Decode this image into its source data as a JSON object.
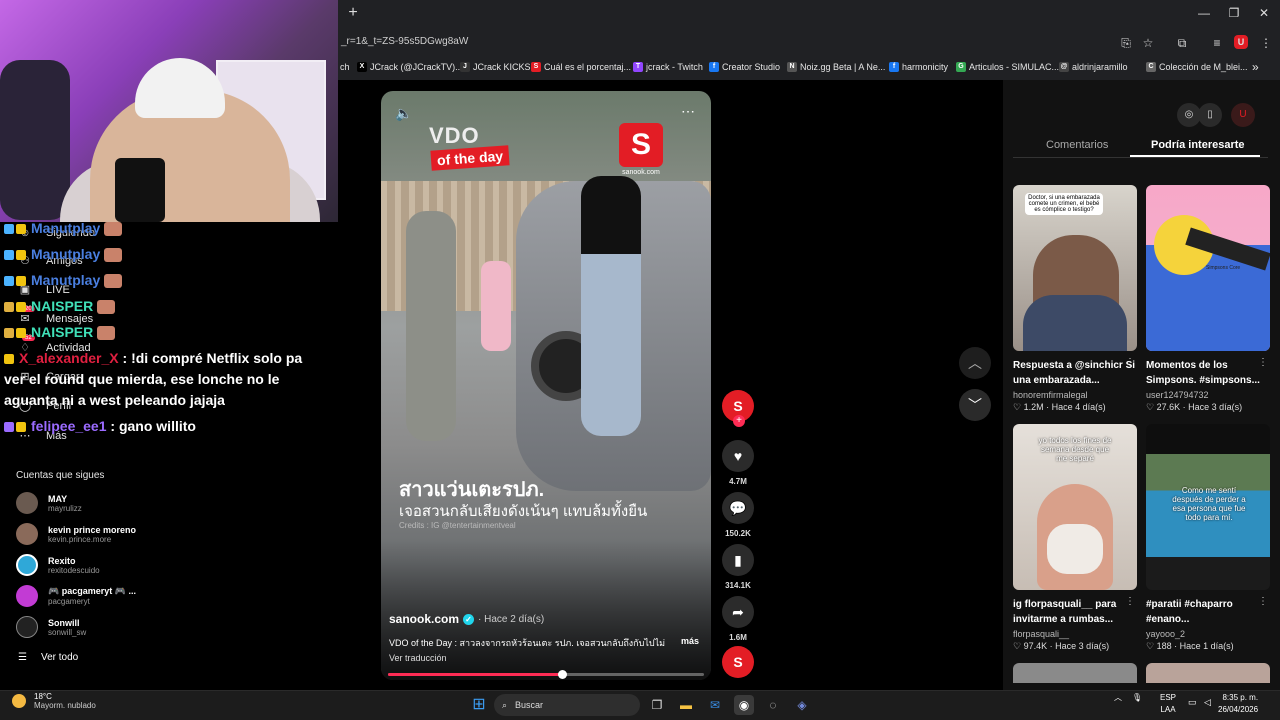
{
  "browser": {
    "url": "_r=1&_t=ZS-95s5DGwg8aW",
    "new_tab": "+",
    "bookmarks": [
      {
        "label": "ch",
        "icon": ""
      },
      {
        "label": "JCrack (@JCrackTV)...",
        "icon": "X"
      },
      {
        "label": "JCrack KICKS",
        "icon": "J"
      },
      {
        "label": "Cuál es el porcentaj...",
        "icon": "S"
      },
      {
        "label": "jcrack - Twitch",
        "icon": "T"
      },
      {
        "label": "Creator Studio",
        "icon": "f"
      },
      {
        "label": "Noiz.gg Beta | A Ne...",
        "icon": "N"
      },
      {
        "label": "harmonicity",
        "icon": "f"
      },
      {
        "label": "Articulos - SIMULAC...",
        "icon": "G"
      },
      {
        "label": "aldrinjaramillo",
        "icon": "@"
      },
      {
        "label": "Colección de M_blei...",
        "icon": "C"
      }
    ],
    "bookmarks_more": "»"
  },
  "sidebar": {
    "nav": [
      {
        "label": "Siguiendo",
        "icon": "following-icon"
      },
      {
        "label": "Amigos",
        "icon": "friends-icon"
      },
      {
        "label": "LIVE",
        "icon": "live-icon"
      },
      {
        "label": "Mensajes",
        "icon": "messages-icon",
        "badge": "20"
      },
      {
        "label": "Actividad",
        "icon": "activity-icon",
        "badge": "52"
      },
      {
        "label": "Cargar",
        "icon": "upload-icon"
      },
      {
        "label": "Perfil",
        "icon": "profile-icon"
      },
      {
        "label": "Más",
        "icon": "more-icon"
      }
    ],
    "following_title": "Cuentas que sigues",
    "following": [
      {
        "name": "MAY",
        "user": "mayrulizz"
      },
      {
        "name": "kevin prince moreno",
        "user": "kevin.prince.more"
      },
      {
        "name": "Rexito",
        "user": "rexitodescuido"
      },
      {
        "name": "🎮 pacgameryt 🎮 ...",
        "user": "pacgameryt"
      },
      {
        "name": "Sonwill",
        "user": "sonwill_sw"
      }
    ],
    "see_all": "Ver todo"
  },
  "chat": [
    {
      "user": "Manutplay",
      "color": "#4a7fe0",
      "text": ""
    },
    {
      "user": "Manutplay",
      "color": "#4a7fe0",
      "text": ""
    },
    {
      "user": "Manutplay",
      "color": "#4a7fe0",
      "text": ""
    },
    {
      "user": "NAISPER",
      "color": "#40e0b8",
      "text": ""
    },
    {
      "user": "NAISPER",
      "color": "#40e0b8",
      "text": ""
    },
    {
      "user": "X_alexander_X",
      "color": "#e02040",
      "text": "!di compré Netflix solo pa"
    },
    {
      "user": "",
      "color": "#ffffff",
      "text": "ver el round que mierda, ese lonche no le"
    },
    {
      "user": "",
      "color": "#ffffff",
      "text": "aguanta ni a west peleando jajaja"
    },
    {
      "user": "felipee_ee1",
      "color": "#9b6bff",
      "text": "gano willito"
    }
  ],
  "video": {
    "logo_line1": "VDO",
    "logo_line2": "of the day",
    "brand_letter": "S",
    "brand_sub": "sanook.com",
    "headline": "สาวแว่นเตะรปภ.",
    "subhead": "เจอสวนกลับเสียงดังเน้นๆ แทบล้มทั้งยืน",
    "credits": "Credits : IG @tentertainmentveal",
    "author": "sanook.com",
    "time": "· Hace 2 día(s)",
    "caption": "VDO of the Day : สาวลงจากรถหัวร้อนเตะ รปภ. เจอสวนกลับถึงกับไปไม่",
    "more": "más",
    "translate": "Ver traducción",
    "progress": 0.55
  },
  "rail": {
    "likes": "4.7M",
    "comments": "150.2K",
    "saves": "314.1K",
    "shares": "1.6M"
  },
  "panel": {
    "tab_comments": "Comentarios",
    "tab_recommend": "Podría interesarte",
    "cards": [
      {
        "title": "Respuesta a @sinchicr Si una embarazada...",
        "author": "honoremfirmalegal",
        "likes": "1.2M",
        "time": "Hace 4 día(s)",
        "overlay": "Doctor, si una embarazada comete un crimen, el bebé es cómplice o testigo?"
      },
      {
        "title": "Momentos de los Simpsons. #simpsons...",
        "author": "user124794732",
        "likes": "27.6K",
        "time": "Hace 3 día(s)",
        "overlay": "Simpsons Core"
      },
      {
        "title": "ig florpasquali__ para invitarme a rumbas...",
        "author": "florpasquali__",
        "likes": "97.4K",
        "time": "Hace 3 día(s)",
        "overlay": "yo todos los fines de semana desde que me separé"
      },
      {
        "title": "#paratii #chaparro #enano...",
        "author": "yayooo_2",
        "likes": "188",
        "time": "Hace 1 día(s)",
        "overlay": "Como me sentí después de perder a esa persona que fue todo para mí."
      }
    ]
  },
  "taskbar": {
    "temp": "18°C",
    "weather": "Mayorm. nublado",
    "search": "Buscar",
    "lang1": "ESP",
    "lang2": "LAA",
    "time": "8:35 p. m.",
    "date": "26/04/2026"
  }
}
